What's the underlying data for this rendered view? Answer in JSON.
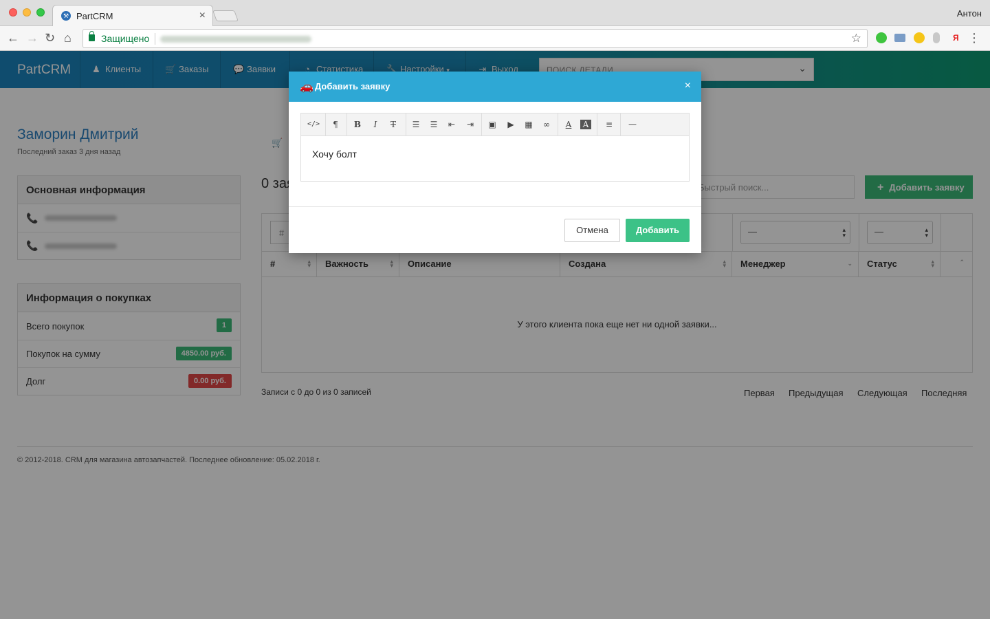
{
  "browser": {
    "tab_title": "PartCRM",
    "secure_label": "Защищено",
    "profile_name": "Антон"
  },
  "nav": {
    "brand": "PartCRM",
    "items": [
      {
        "label": "Клиенты",
        "icon": "user-icon"
      },
      {
        "label": "Заказы",
        "icon": "cart-icon"
      },
      {
        "label": "Заявки",
        "icon": "chat-icon"
      },
      {
        "label": "Статистика",
        "icon": "pie-chart-icon"
      },
      {
        "label": "Настройки",
        "icon": "wrench-icon"
      },
      {
        "label": "Выход",
        "icon": "exit-icon"
      }
    ],
    "search_placeholder": "ПОИСК ДЕТАЛИ"
  },
  "client": {
    "name": "Заморин Дмитрий",
    "last_order": "Последний заказ 3 дня назад"
  },
  "basic_info": {
    "title": "Основная информация",
    "phones": [
      "+7 (913) 057-22-89",
      "+7 (913) 057-22-89"
    ]
  },
  "purchases": {
    "title": "Информация о покупках",
    "rows": [
      {
        "label": "Всего покупок",
        "value": "1",
        "color": "#3cb878"
      },
      {
        "label": "Покупок на сумму",
        "value": "4850.00 руб.",
        "color": "#3cb878"
      },
      {
        "label": "Долг",
        "value": "0.00 руб.",
        "color": "#e14848"
      }
    ]
  },
  "orders": {
    "title": "0 заявок",
    "quick_search_placeholder": "Быстрый поиск...",
    "add_button": "Добавить заявку",
    "filter_num_placeholder": "#",
    "filter_manager": "—",
    "filter_status": "—",
    "columns": [
      "#",
      "Важность",
      "Описание",
      "Создана",
      "Менеджер",
      "Статус"
    ],
    "empty_message": "У этого клиента пока еще нет ни одной заявки...",
    "records_info": "Записи с 0 до 0 из 0 записей",
    "pager": [
      "Первая",
      "Предыдущая",
      "Следующая",
      "Последняя"
    ]
  },
  "footer": "© 2012-2018. CRM для магазина автозапчастей. Последнее обновление: 05.02.2018 г.",
  "modal": {
    "title": "Добавить заявку",
    "editor_text": "Хочу болт",
    "cancel": "Отмена",
    "submit": "Добавить"
  }
}
